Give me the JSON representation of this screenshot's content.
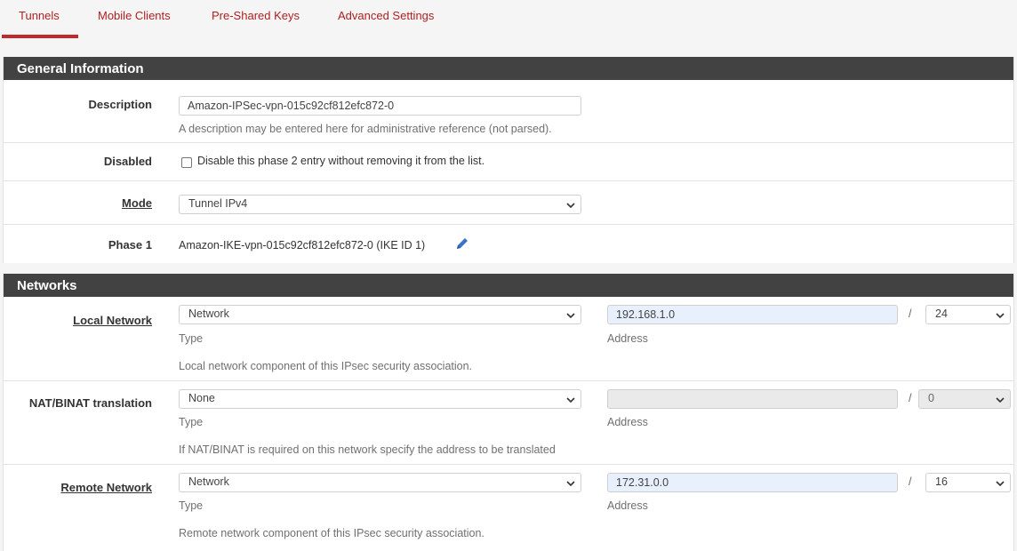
{
  "tabs": [
    {
      "label": "Tunnels"
    },
    {
      "label": "Mobile Clients"
    },
    {
      "label": "Pre-Shared Keys"
    },
    {
      "label": "Advanced Settings"
    }
  ],
  "general": {
    "header": "General Information",
    "description": {
      "label": "Description",
      "value": "Amazon-IPSec-vpn-015c92cf812efc872-0",
      "help": "A description may be entered here for administrative reference (not parsed)."
    },
    "disabled": {
      "label": "Disabled",
      "checkbox_label": "Disable this phase 2 entry without removing it from the list."
    },
    "mode": {
      "label": "Mode",
      "value": "Tunnel IPv4"
    },
    "phase1": {
      "label": "Phase 1",
      "value": "Amazon-IKE-vpn-015c92cf812efc872-0 (IKE ID 1)"
    }
  },
  "networks": {
    "header": "Networks",
    "local": {
      "label": "Local Network",
      "type": "Network",
      "type_help": "Type",
      "address": "192.168.1.0",
      "address_help": "Address",
      "slash": "/",
      "mask": "24",
      "help": "Local network component of this IPsec security association."
    },
    "nat": {
      "label": "NAT/BINAT translation",
      "type": "None",
      "type_help": "Type",
      "address": "",
      "address_help": "Address",
      "slash": "/",
      "mask": "0",
      "help": "If NAT/BINAT is required on this network specify the address to be translated"
    },
    "remote": {
      "label": "Remote Network",
      "type": "Network",
      "type_help": "Type",
      "address": "172.31.0.0",
      "address_help": "Address",
      "slash": "/",
      "mask": "16",
      "help": "Remote network component of this IPsec security association."
    }
  },
  "colors": {
    "accent": "#b21e1e",
    "header_bg": "#424242",
    "icon_blue": "#3b73c5"
  }
}
